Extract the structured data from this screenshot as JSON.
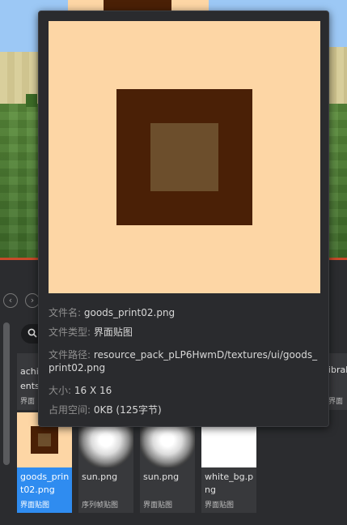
{
  "tooltip": {
    "file_name_label": "文件名:",
    "file_name": "goods_print02.png",
    "file_type_label": "文件类型:",
    "file_type": "界面贴图",
    "file_path_label": "文件路径:",
    "file_path": "resource_pack_pLP6HwmD/textures/ui/goods_print02.png",
    "size_label": "大小:",
    "size": "16 X 16",
    "space_label": "占用空间:",
    "space": "0KB (125字节)"
  },
  "browser": {
    "nav_back_icon": "chevron-left-icon",
    "nav_forward_icon": "chevron-right-icon",
    "search_icon": "search-icon",
    "partial_left": {
      "name": "achievements",
      "name_visible": "achi ents",
      "type": "界面"
    },
    "partial_right": {
      "name_visible": "ibrah",
      "type": "界面"
    },
    "assets": [
      {
        "name": "goods_print02.png",
        "type": "界面贴图",
        "selected": true
      },
      {
        "name": "sun.png",
        "type": "序列帧贴图",
        "selected": false
      },
      {
        "name": "sun.png",
        "type": "界面贴图",
        "selected": false
      },
      {
        "name": "white_bg.png",
        "type": "界面贴图",
        "selected": false
      }
    ]
  },
  "colors": {
    "accent_selected": "#2f8cf0",
    "preview_light": "#fdd6a5",
    "preview_dark": "#4a2006",
    "preview_center": "#6c4e2c"
  }
}
